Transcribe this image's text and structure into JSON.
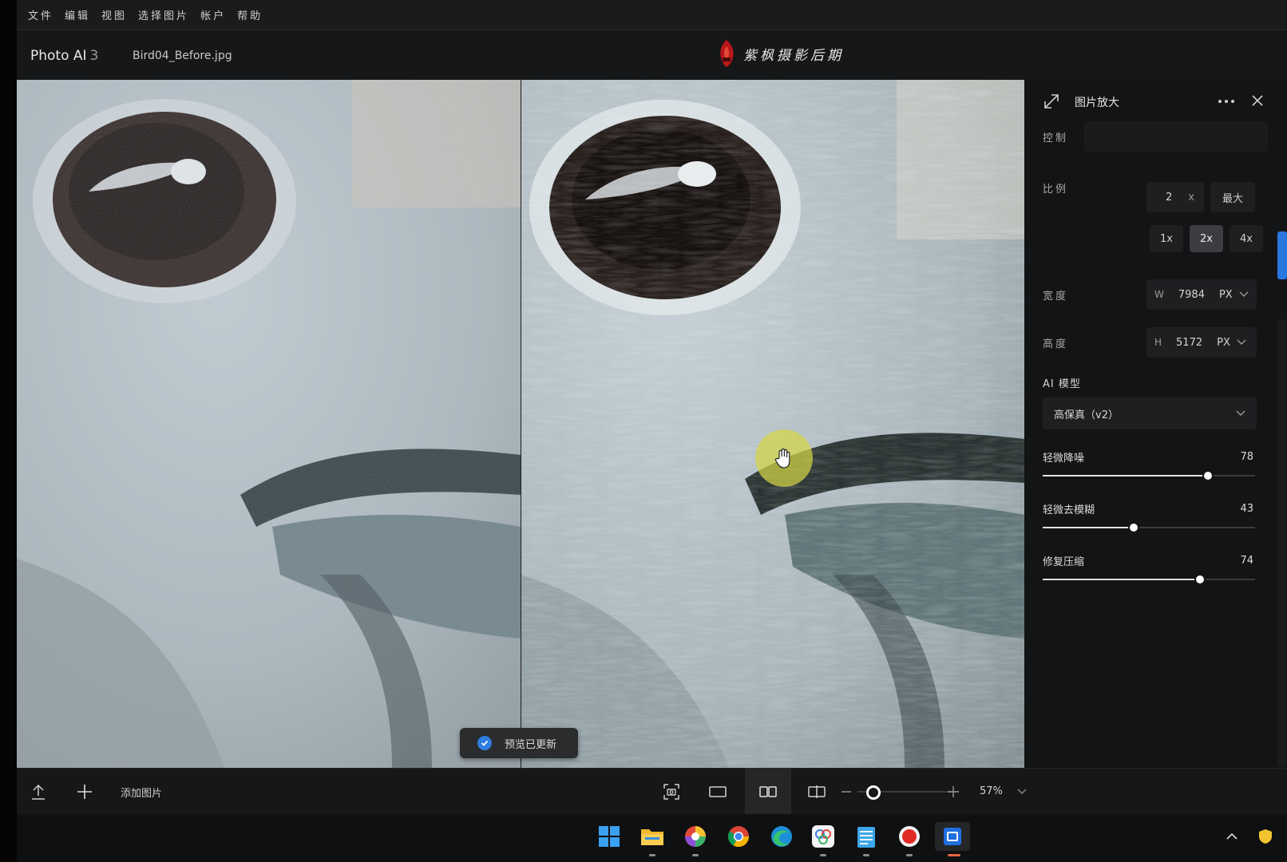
{
  "menu": [
    "文件",
    "编辑",
    "视图",
    "选择图片",
    "帐户",
    "帮助"
  ],
  "header": {
    "app_name": "Photo AI",
    "app_version": "3",
    "file_name": "Bird04_Before.jpg",
    "watermark": "紫枫摄影后期"
  },
  "canvas": {
    "toast": "预览已更新"
  },
  "panel": {
    "title": "图片放大",
    "control_label": "控制",
    "scale_label": "比例",
    "scale_value": "2",
    "scale_suffix": "x",
    "max_label": "最大",
    "presets": [
      {
        "label": "1x",
        "selected": false
      },
      {
        "label": "2x",
        "selected": true
      },
      {
        "label": "4x",
        "selected": false
      }
    ],
    "width_label": "宽度",
    "width_prefix": "W",
    "width_value": "7984",
    "width_unit": "PX",
    "height_label": "高度",
    "height_prefix": "H",
    "height_value": "5172",
    "height_unit": "PX",
    "model_label": "AI 模型",
    "model_value": "高保真（v2）",
    "sliders": [
      {
        "label": "轻微降噪",
        "value": 78,
        "fraction": 0.78
      },
      {
        "label": "轻微去模糊",
        "value": 43,
        "fraction": 0.43
      },
      {
        "label": "修复压缩",
        "value": 74,
        "fraction": 0.74
      }
    ]
  },
  "toolbar": {
    "add_image_label": "添加图片",
    "zoom_value": "57%",
    "zoom_fraction": 0.2
  },
  "colors": {
    "accent": "#2b77e0",
    "panel_bg": "#131415",
    "cursor_highlight": "#d6d646"
  }
}
